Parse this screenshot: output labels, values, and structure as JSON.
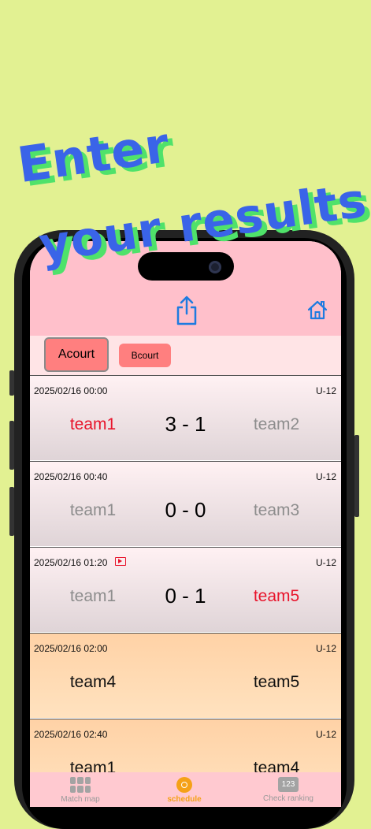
{
  "promo": {
    "line1": "Enter",
    "line2": "your results"
  },
  "header": {
    "share_icon": "share-icon",
    "home_icon": "home-icon"
  },
  "courts": {
    "active": "Acourt",
    "other": "Bcourt"
  },
  "matches": [
    {
      "datetime": "2025/02/16 00:00",
      "category": "U-12",
      "team1": "team1",
      "score": "3 - 1",
      "team2": "team2",
      "winner": "team1"
    },
    {
      "datetime": "2025/02/16 00:40",
      "category": "U-12",
      "team1": "team1",
      "score": "0 - 0",
      "team2": "team3",
      "winner": "none"
    },
    {
      "datetime": "2025/02/16 01:20",
      "category": "U-12",
      "team1": "team1",
      "score": "0 - 1",
      "team2": "team5",
      "winner": "team2",
      "has_video": true
    },
    {
      "datetime": "2025/02/16 02:00",
      "category": "U-12",
      "team1": "team4",
      "score": "",
      "team2": "team5",
      "winner": "pending"
    },
    {
      "datetime": "2025/02/16 02:40",
      "category": "U-12",
      "team1": "team1",
      "score": "",
      "team2": "team4",
      "winner": "pending"
    }
  ],
  "tabbar": {
    "match_map": "Match map",
    "schedule": "schedule",
    "check_ranking": "Check ranking",
    "ranking_icon_text": "123"
  },
  "colors": {
    "background": "#e2f192",
    "headline": "#3a64e8",
    "headline_shadow": "#4fe26a",
    "header": "#ffc0cb",
    "win": "#e8142b",
    "lose": "#8d8d8d",
    "active_tab": "#f5a117"
  }
}
